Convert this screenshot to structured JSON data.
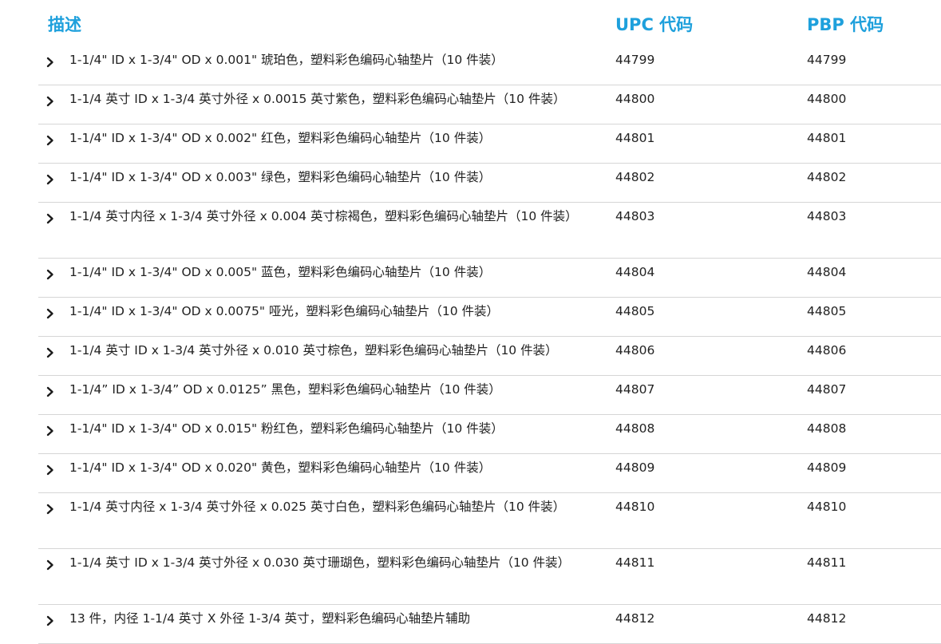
{
  "header": {
    "description": "描述",
    "upc": "UPC 代码",
    "pbp": "PBP 代码"
  },
  "colors": {
    "accent": "#1ea0dc",
    "divider": "#d6d6d6",
    "text": "#222222"
  },
  "rows": [
    {
      "description": "1-1/4\" ID x 1-3/4\" OD x 0.001\" 琥珀色，塑料彩色编码心轴垫片（10 件装）",
      "upc": "44799",
      "pbp": "44799",
      "lines": 1
    },
    {
      "description": "1-1/4 英寸 ID x 1-3/4 英寸外径 x 0.0015 英寸紫色，塑料彩色编码心轴垫片（10 件装）",
      "upc": "44800",
      "pbp": "44800",
      "lines": 1
    },
    {
      "description": "1-1/4\" ID x 1-3/4\" OD x 0.002\" 红色，塑料彩色编码心轴垫片（10 件装）",
      "upc": "44801",
      "pbp": "44801",
      "lines": 1
    },
    {
      "description": "1-1/4\" ID x 1-3/4\" OD x 0.003\" 绿色，塑料彩色编码心轴垫片（10 件装）",
      "upc": "44802",
      "pbp": "44802",
      "lines": 1
    },
    {
      "description": "1-1/4 英寸内径 x 1-3/4 英寸外径 x 0.004 英寸棕褐色，塑料彩色编码心轴垫片（10 件装）",
      "upc": "44803",
      "pbp": "44803",
      "lines": 2
    },
    {
      "description": "1-1/4\" ID x 1-3/4\" OD x 0.005\" 蓝色，塑料彩色编码心轴垫片（10 件装）",
      "upc": "44804",
      "pbp": "44804",
      "lines": 1
    },
    {
      "description": "1-1/4\" ID x 1-3/4\" OD x 0.0075\" 哑光，塑料彩色编码心轴垫片（10 件装）",
      "upc": "44805",
      "pbp": "44805",
      "lines": 1
    },
    {
      "description": "1-1/4 英寸 ID x 1-3/4 英寸外径 x 0.010 英寸棕色，塑料彩色编码心轴垫片（10 件装）",
      "upc": "44806",
      "pbp": "44806",
      "lines": 1
    },
    {
      "description": "1-1/4” ID x 1-3/4” OD x 0.0125” 黑色，塑料彩色编码心轴垫片（10 件装）",
      "upc": "44807",
      "pbp": "44807",
      "lines": 1
    },
    {
      "description": "1-1/4\" ID x 1-3/4\" OD x 0.015\" 粉红色，塑料彩色编码心轴垫片（10 件装）",
      "upc": "44808",
      "pbp": "44808",
      "lines": 1
    },
    {
      "description": "1-1/4\" ID x 1-3/4\" OD x 0.020\" 黄色，塑料彩色编码心轴垫片（10 件装）",
      "upc": "44809",
      "pbp": "44809",
      "lines": 1
    },
    {
      "description": "1-1/4 英寸内径 x 1-3/4 英寸外径 x 0.025 英寸白色，塑料彩色编码心轴垫片（10 件装）",
      "upc": "44810",
      "pbp": "44810",
      "lines": 2
    },
    {
      "description": "1-1/4 英寸 ID x 1-3/4 英寸外径 x 0.030 英寸珊瑚色，塑料彩色编码心轴垫片（10 件装）",
      "upc": "44811",
      "pbp": "44811",
      "lines": 2
    },
    {
      "description": "13 件，内径 1-1/4 英寸 X 外径 1-3/4 英寸，塑料彩色编码心轴垫片辅助",
      "upc": "44812",
      "pbp": "44812",
      "lines": 1
    }
  ]
}
